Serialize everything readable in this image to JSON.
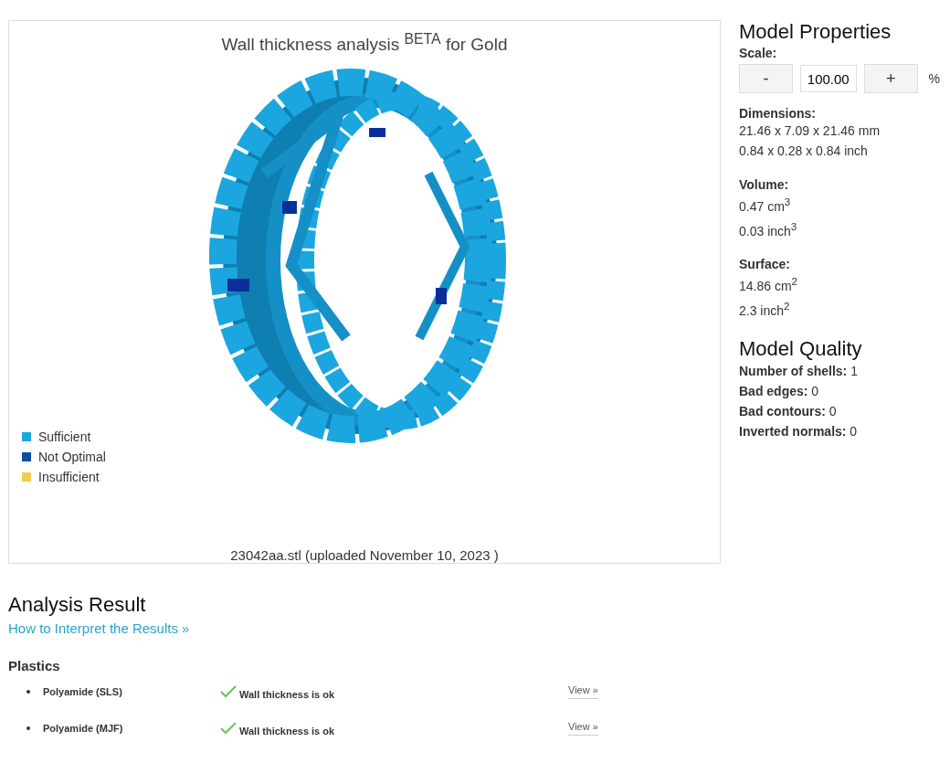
{
  "viewer": {
    "title": "Wall thickness analysis $^{BETA}$ for Gold",
    "legend": [
      {
        "label": "Sufficient",
        "color": "#1ba6e0"
      },
      {
        "label": "Not Optimal",
        "color": "#0b4fa3"
      },
      {
        "label": "Insufficient",
        "color": "#f5cb4a"
      }
    ],
    "caption": "23042aa.stl (uploaded November 10, 2023 )"
  },
  "model_properties": {
    "title": "Model Properties",
    "scale": {
      "label": "Scale:",
      "minus": "-",
      "value": "100.00",
      "plus": "+",
      "unit": "%"
    },
    "sections": [
      {
        "label": "Dimensions:",
        "lines": [
          "21.46 x 7.09 x 21.46 mm",
          "0.84 x 0.28 x 0.84 inch"
        ]
      },
      {
        "label": "Volume:",
        "lines": [
          "0.47 cm$^{3}$",
          "0.03 inch$^{3}$"
        ]
      },
      {
        "label": "Surface:",
        "lines": [
          "14.86 cm$^{2}$",
          "2.3 inch$^{2}$"
        ]
      }
    ]
  },
  "model_quality": {
    "title": "Model Quality",
    "items": [
      "**Number of shells:** 1",
      "**Bad edges:** 0",
      "**Bad contours:** 0",
      "**Inverted normals:** 0"
    ]
  },
  "analysis": {
    "title": "Analysis Result",
    "link": "How to Interpret the Results »",
    "group": "Plastics",
    "rows": [
      {
        "material": "Polyamide (SLS)",
        "status": "Wall thickness is ok",
        "action": "View »"
      },
      {
        "material": "Polyamide (MJF)",
        "status": "Wall thickness is ok",
        "action": "View »"
      }
    ]
  }
}
